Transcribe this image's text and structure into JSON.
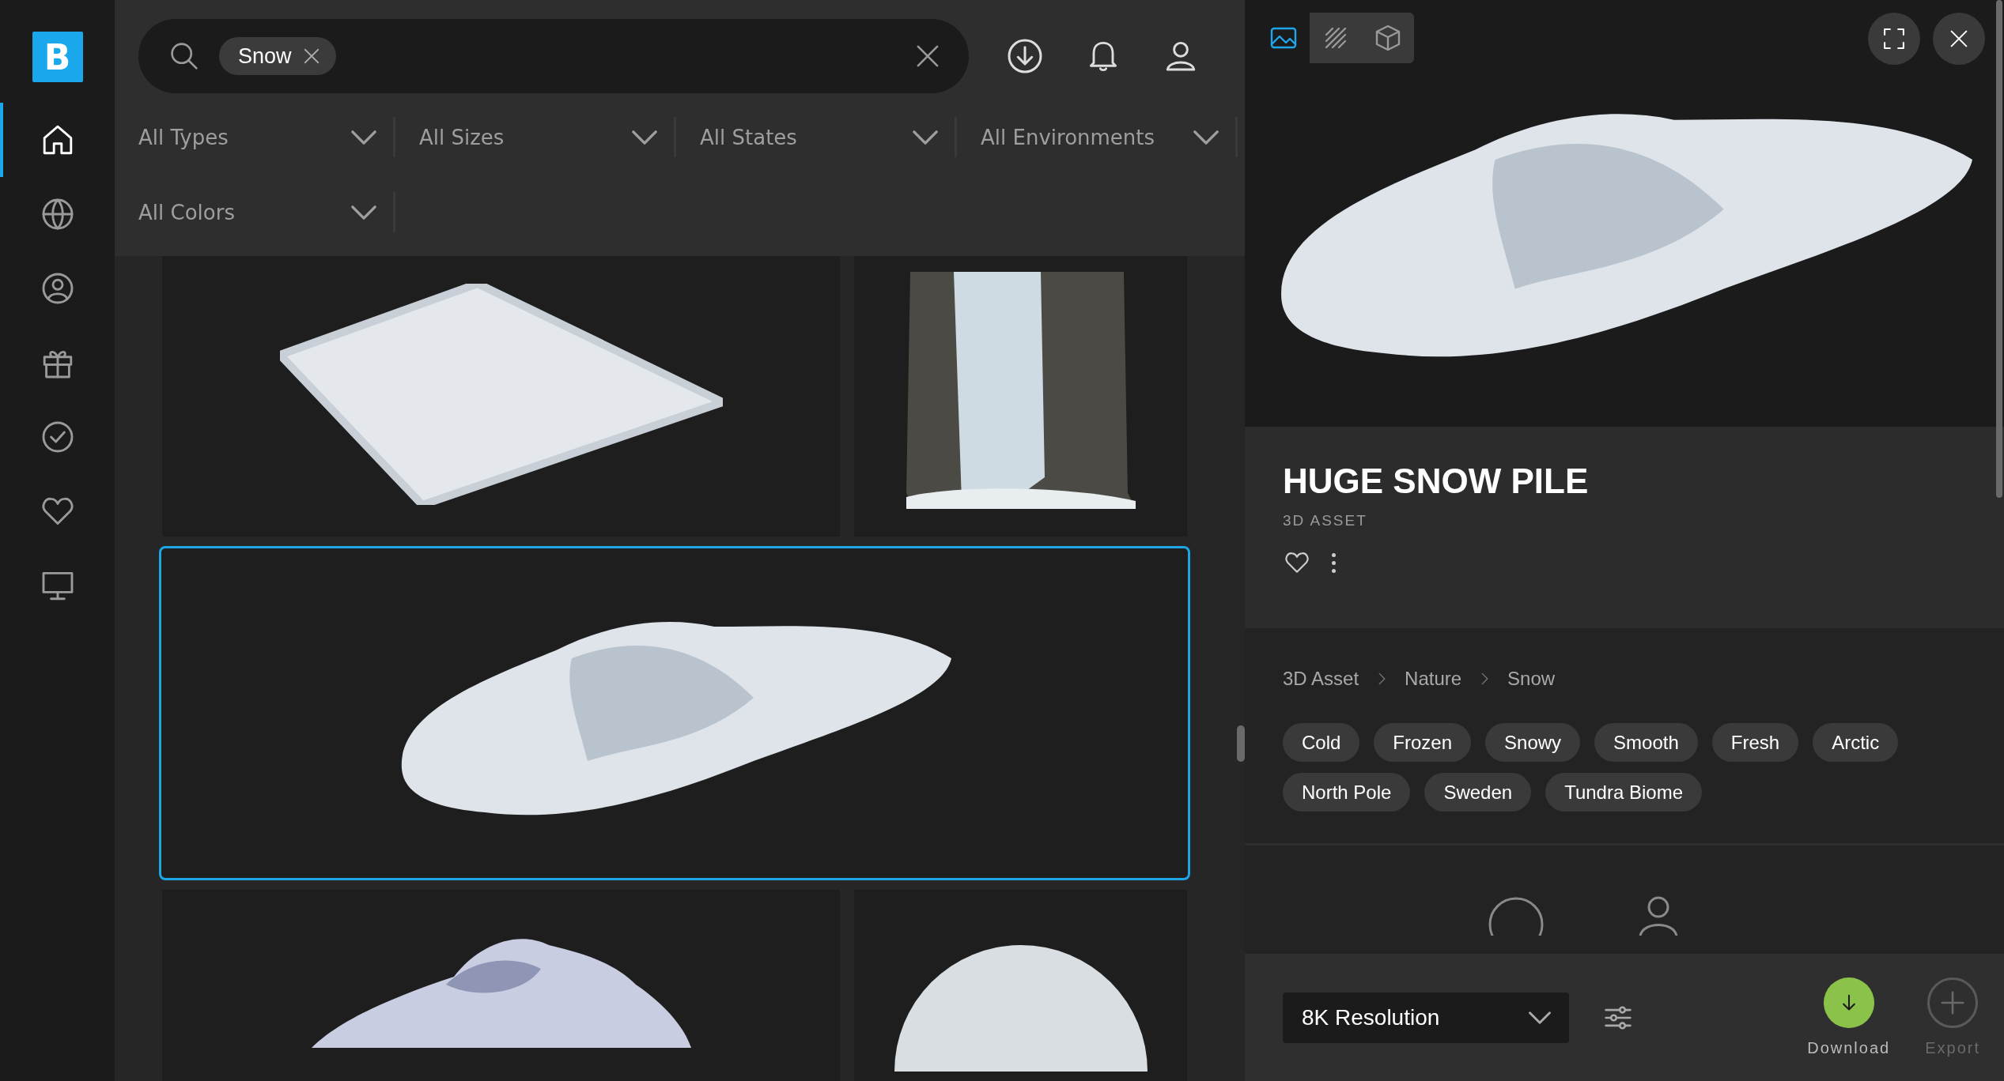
{
  "logo": "B",
  "sidebar": {
    "items": [
      {
        "kind": "home",
        "selected": true
      },
      {
        "kind": "globe",
        "selected": false
      },
      {
        "kind": "user",
        "selected": false
      },
      {
        "kind": "gift",
        "selected": false
      },
      {
        "kind": "check",
        "selected": false
      },
      {
        "kind": "heart",
        "selected": false
      },
      {
        "kind": "monitor",
        "selected": false
      }
    ]
  },
  "search": {
    "chips": [
      {
        "label": "Snow"
      }
    ]
  },
  "filters": [
    {
      "label": "All Types"
    },
    {
      "label": "All Sizes"
    },
    {
      "label": "All States"
    },
    {
      "label": "All Environments"
    },
    {
      "label": "All Colors"
    }
  ],
  "grid": {
    "cards": [
      {
        "kind": "plate",
        "selected": false
      },
      {
        "kind": "waterfall",
        "selected": false
      },
      {
        "kind": "pile",
        "selected": true
      },
      {
        "kind": "rock",
        "selected": false
      },
      {
        "kind": "sphere",
        "selected": false
      }
    ]
  },
  "viewer": {
    "tabs": [
      {
        "kind": "image",
        "selected": true
      },
      {
        "kind": "texture",
        "selected": false
      },
      {
        "kind": "model",
        "selected": false
      }
    ]
  },
  "asset": {
    "title": "HUGE SNOW PILE",
    "type": "3D ASSET",
    "breadcrumb": [
      "3D Asset",
      "Nature",
      "Snow"
    ],
    "tags": [
      "Cold",
      "Frozen",
      "Snowy",
      "Smooth",
      "Fresh",
      "Arctic",
      "North Pole",
      "Sweden",
      "Tundra Biome"
    ]
  },
  "resolution": {
    "value": "8K Resolution"
  },
  "actions": [
    {
      "kind": "download",
      "label": "Download",
      "disabled": false
    },
    {
      "kind": "export",
      "label": "Export",
      "disabled": true
    }
  ]
}
